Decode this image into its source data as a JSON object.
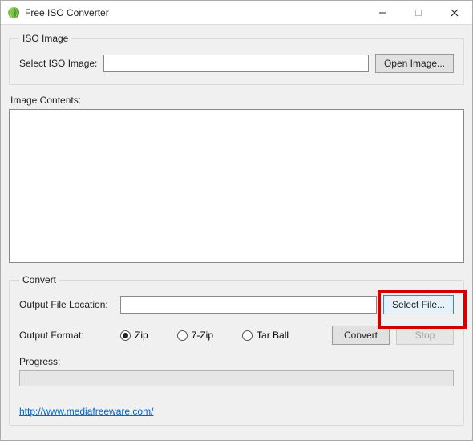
{
  "window": {
    "title": "Free ISO Converter"
  },
  "iso_group": {
    "legend": "ISO Image",
    "select_label": "Select ISO Image:",
    "path_value": "",
    "open_button": "Open Image..."
  },
  "contents": {
    "label": "Image Contents:"
  },
  "convert_group": {
    "legend": "Convert",
    "output_location_label": "Output File Location:",
    "output_location_value": "",
    "select_file_button": "Select File...",
    "output_format_label": "Output Format:",
    "formats": {
      "zip": {
        "label": "Zip",
        "checked": true
      },
      "sevenzip": {
        "label": "7-Zip",
        "checked": false
      },
      "tarball": {
        "label": "Tar Ball",
        "checked": false
      }
    },
    "convert_button": "Convert",
    "stop_button": "Stop",
    "progress_label": "Progress:",
    "link": "http://www.mediafreeware.com/"
  }
}
